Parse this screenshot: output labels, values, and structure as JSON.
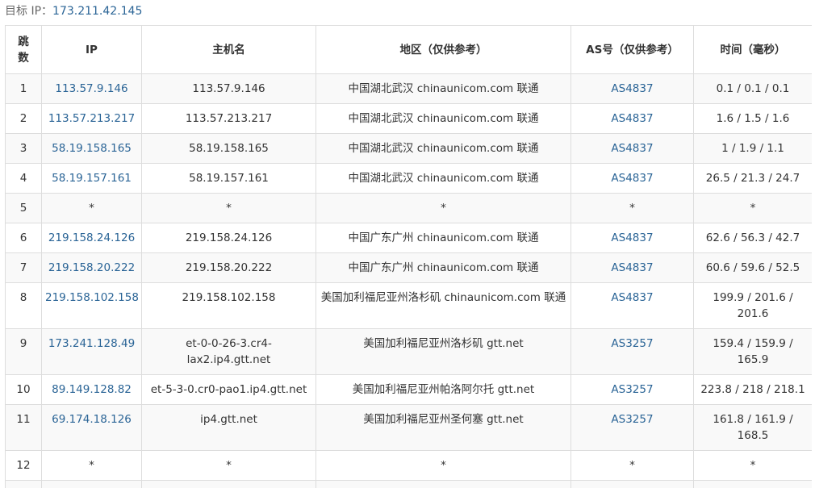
{
  "target": {
    "label": "目标 IP：",
    "ip": "173.211.42.145"
  },
  "table": {
    "headers": {
      "hop": "跳数",
      "ip": "IP",
      "hostname": "主机名",
      "region": "地区（仅供参考）",
      "as": "AS号（仅供参考）",
      "time": "时间（毫秒）"
    },
    "rows": [
      {
        "hop": "1",
        "ip": "113.57.9.146",
        "hostname": "113.57.9.146",
        "region": "中国湖北武汉 chinaunicom.com 联通",
        "as": "AS4837",
        "time": "0.1 / 0.1 / 0.1"
      },
      {
        "hop": "2",
        "ip": "113.57.213.217",
        "hostname": "113.57.213.217",
        "region": "中国湖北武汉 chinaunicom.com 联通",
        "as": "AS4837",
        "time": "1.6 / 1.5 / 1.6"
      },
      {
        "hop": "3",
        "ip": "58.19.158.165",
        "hostname": "58.19.158.165",
        "region": "中国湖北武汉 chinaunicom.com 联通",
        "as": "AS4837",
        "time": "1 / 1.9 / 1.1"
      },
      {
        "hop": "4",
        "ip": "58.19.157.161",
        "hostname": "58.19.157.161",
        "region": "中国湖北武汉 chinaunicom.com 联通",
        "as": "AS4837",
        "time": "26.5 / 21.3 / 24.7"
      },
      {
        "hop": "5",
        "ip": "*",
        "hostname": "*",
        "region": "*",
        "as": "*",
        "time": "*"
      },
      {
        "hop": "6",
        "ip": "219.158.24.126",
        "hostname": "219.158.24.126",
        "region": "中国广东广州 chinaunicom.com 联通",
        "as": "AS4837",
        "time": "62.6 / 56.3 / 42.7"
      },
      {
        "hop": "7",
        "ip": "219.158.20.222",
        "hostname": "219.158.20.222",
        "region": "中国广东广州 chinaunicom.com 联通",
        "as": "AS4837",
        "time": "60.6 / 59.6 / 52.5"
      },
      {
        "hop": "8",
        "ip": "219.158.102.158",
        "hostname": "219.158.102.158",
        "region": "美国加利福尼亚州洛杉矶 chinaunicom.com 联通",
        "as": "AS4837",
        "time": "199.9 / 201.6 / 201.6"
      },
      {
        "hop": "9",
        "ip": "173.241.128.49",
        "hostname": "et-0-0-26-3.cr4-lax2.ip4.gtt.net",
        "region": "美国加利福尼亚州洛杉矶 gtt.net",
        "as": "AS3257",
        "time": "159.4 / 159.9 / 165.9"
      },
      {
        "hop": "10",
        "ip": "89.149.128.82",
        "hostname": "et-5-3-0.cr0-pao1.ip4.gtt.net",
        "region": "美国加利福尼亚州帕洛阿尔托 gtt.net",
        "as": "AS3257",
        "time": "223.8 / 218 / 218.1"
      },
      {
        "hop": "11",
        "ip": "69.174.18.126",
        "hostname": "ip4.gtt.net",
        "region": "美国加利福尼亚州圣何塞 gtt.net",
        "as": "AS3257",
        "time": "161.8 / 161.9 / 168.5"
      },
      {
        "hop": "12",
        "ip": "*",
        "hostname": "*",
        "region": "*",
        "as": "*",
        "time": "*"
      }
    ]
  }
}
